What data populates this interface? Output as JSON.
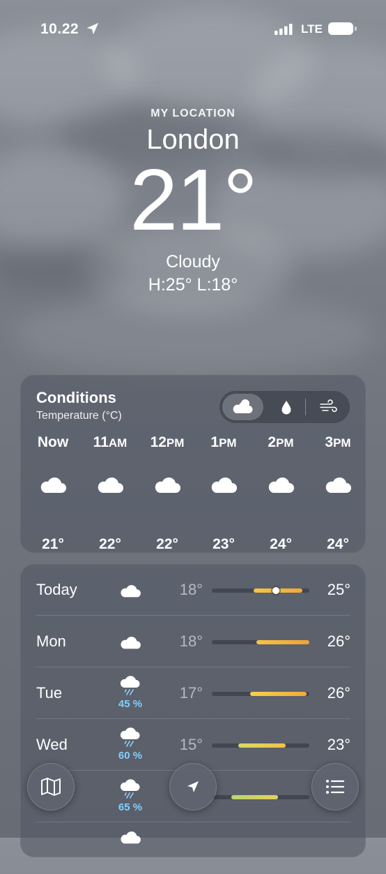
{
  "status": {
    "time": "10.22",
    "network": "LTE"
  },
  "header": {
    "subtitle": "MY LOCATION",
    "city": "London",
    "temperature": "21°",
    "condition": "Cloudy",
    "high_low": "H:25°  L:18°"
  },
  "conditions": {
    "title": "Conditions",
    "subtitle": "Temperature (°C)",
    "segments": [
      "cloud-sun-icon",
      "raindrop-icon",
      "wind-icon"
    ],
    "hours": [
      {
        "label": "Now",
        "ampm": "",
        "icon": "cloud-icon",
        "temp": "21°"
      },
      {
        "label": "11",
        "ampm": "AM",
        "icon": "cloud-icon",
        "temp": "22°"
      },
      {
        "label": "12",
        "ampm": "PM",
        "icon": "cloud-icon",
        "temp": "22°"
      },
      {
        "label": "1",
        "ampm": "PM",
        "icon": "cloud-icon",
        "temp": "23°"
      },
      {
        "label": "2",
        "ampm": "PM",
        "icon": "cloud-icon",
        "temp": "24°"
      },
      {
        "label": "3",
        "ampm": "PM",
        "icon": "cloud-icon",
        "temp": "24°"
      }
    ]
  },
  "daily": [
    {
      "day": "Today",
      "icon": "cloud-icon",
      "precip": "",
      "low": "18°",
      "high": "25°",
      "range_start": 0.43,
      "range_end": 0.93,
      "current": 0.66,
      "colors": [
        "#f4c542",
        "#f0a93a"
      ]
    },
    {
      "day": "Mon",
      "icon": "cloud-icon",
      "precip": "",
      "low": "18°",
      "high": "26°",
      "range_start": 0.46,
      "range_end": 1.0,
      "colors": [
        "#f4c542",
        "#f0a03a"
      ]
    },
    {
      "day": "Tue",
      "icon": "cloud-rain-icon",
      "precip": "45 %",
      "low": "17°",
      "high": "26°",
      "range_start": 0.39,
      "range_end": 0.97,
      "colors": [
        "#f4d24a",
        "#f0ab3a"
      ]
    },
    {
      "day": "Wed",
      "icon": "cloud-rain-icon",
      "precip": "60 %",
      "low": "15°",
      "high": "23°",
      "range_start": 0.27,
      "range_end": 0.76,
      "colors": [
        "#d8d866",
        "#f2c340"
      ]
    },
    {
      "day": "",
      "icon": "cloud-rain-icon",
      "precip": "65 %",
      "low": "",
      "high": "",
      "range_start": 0.2,
      "range_end": 0.68,
      "colors": [
        "#bcd46e",
        "#e2d15a"
      ]
    }
  ],
  "nav": [
    "map-icon",
    "location-arrow-icon",
    "list-icon"
  ]
}
